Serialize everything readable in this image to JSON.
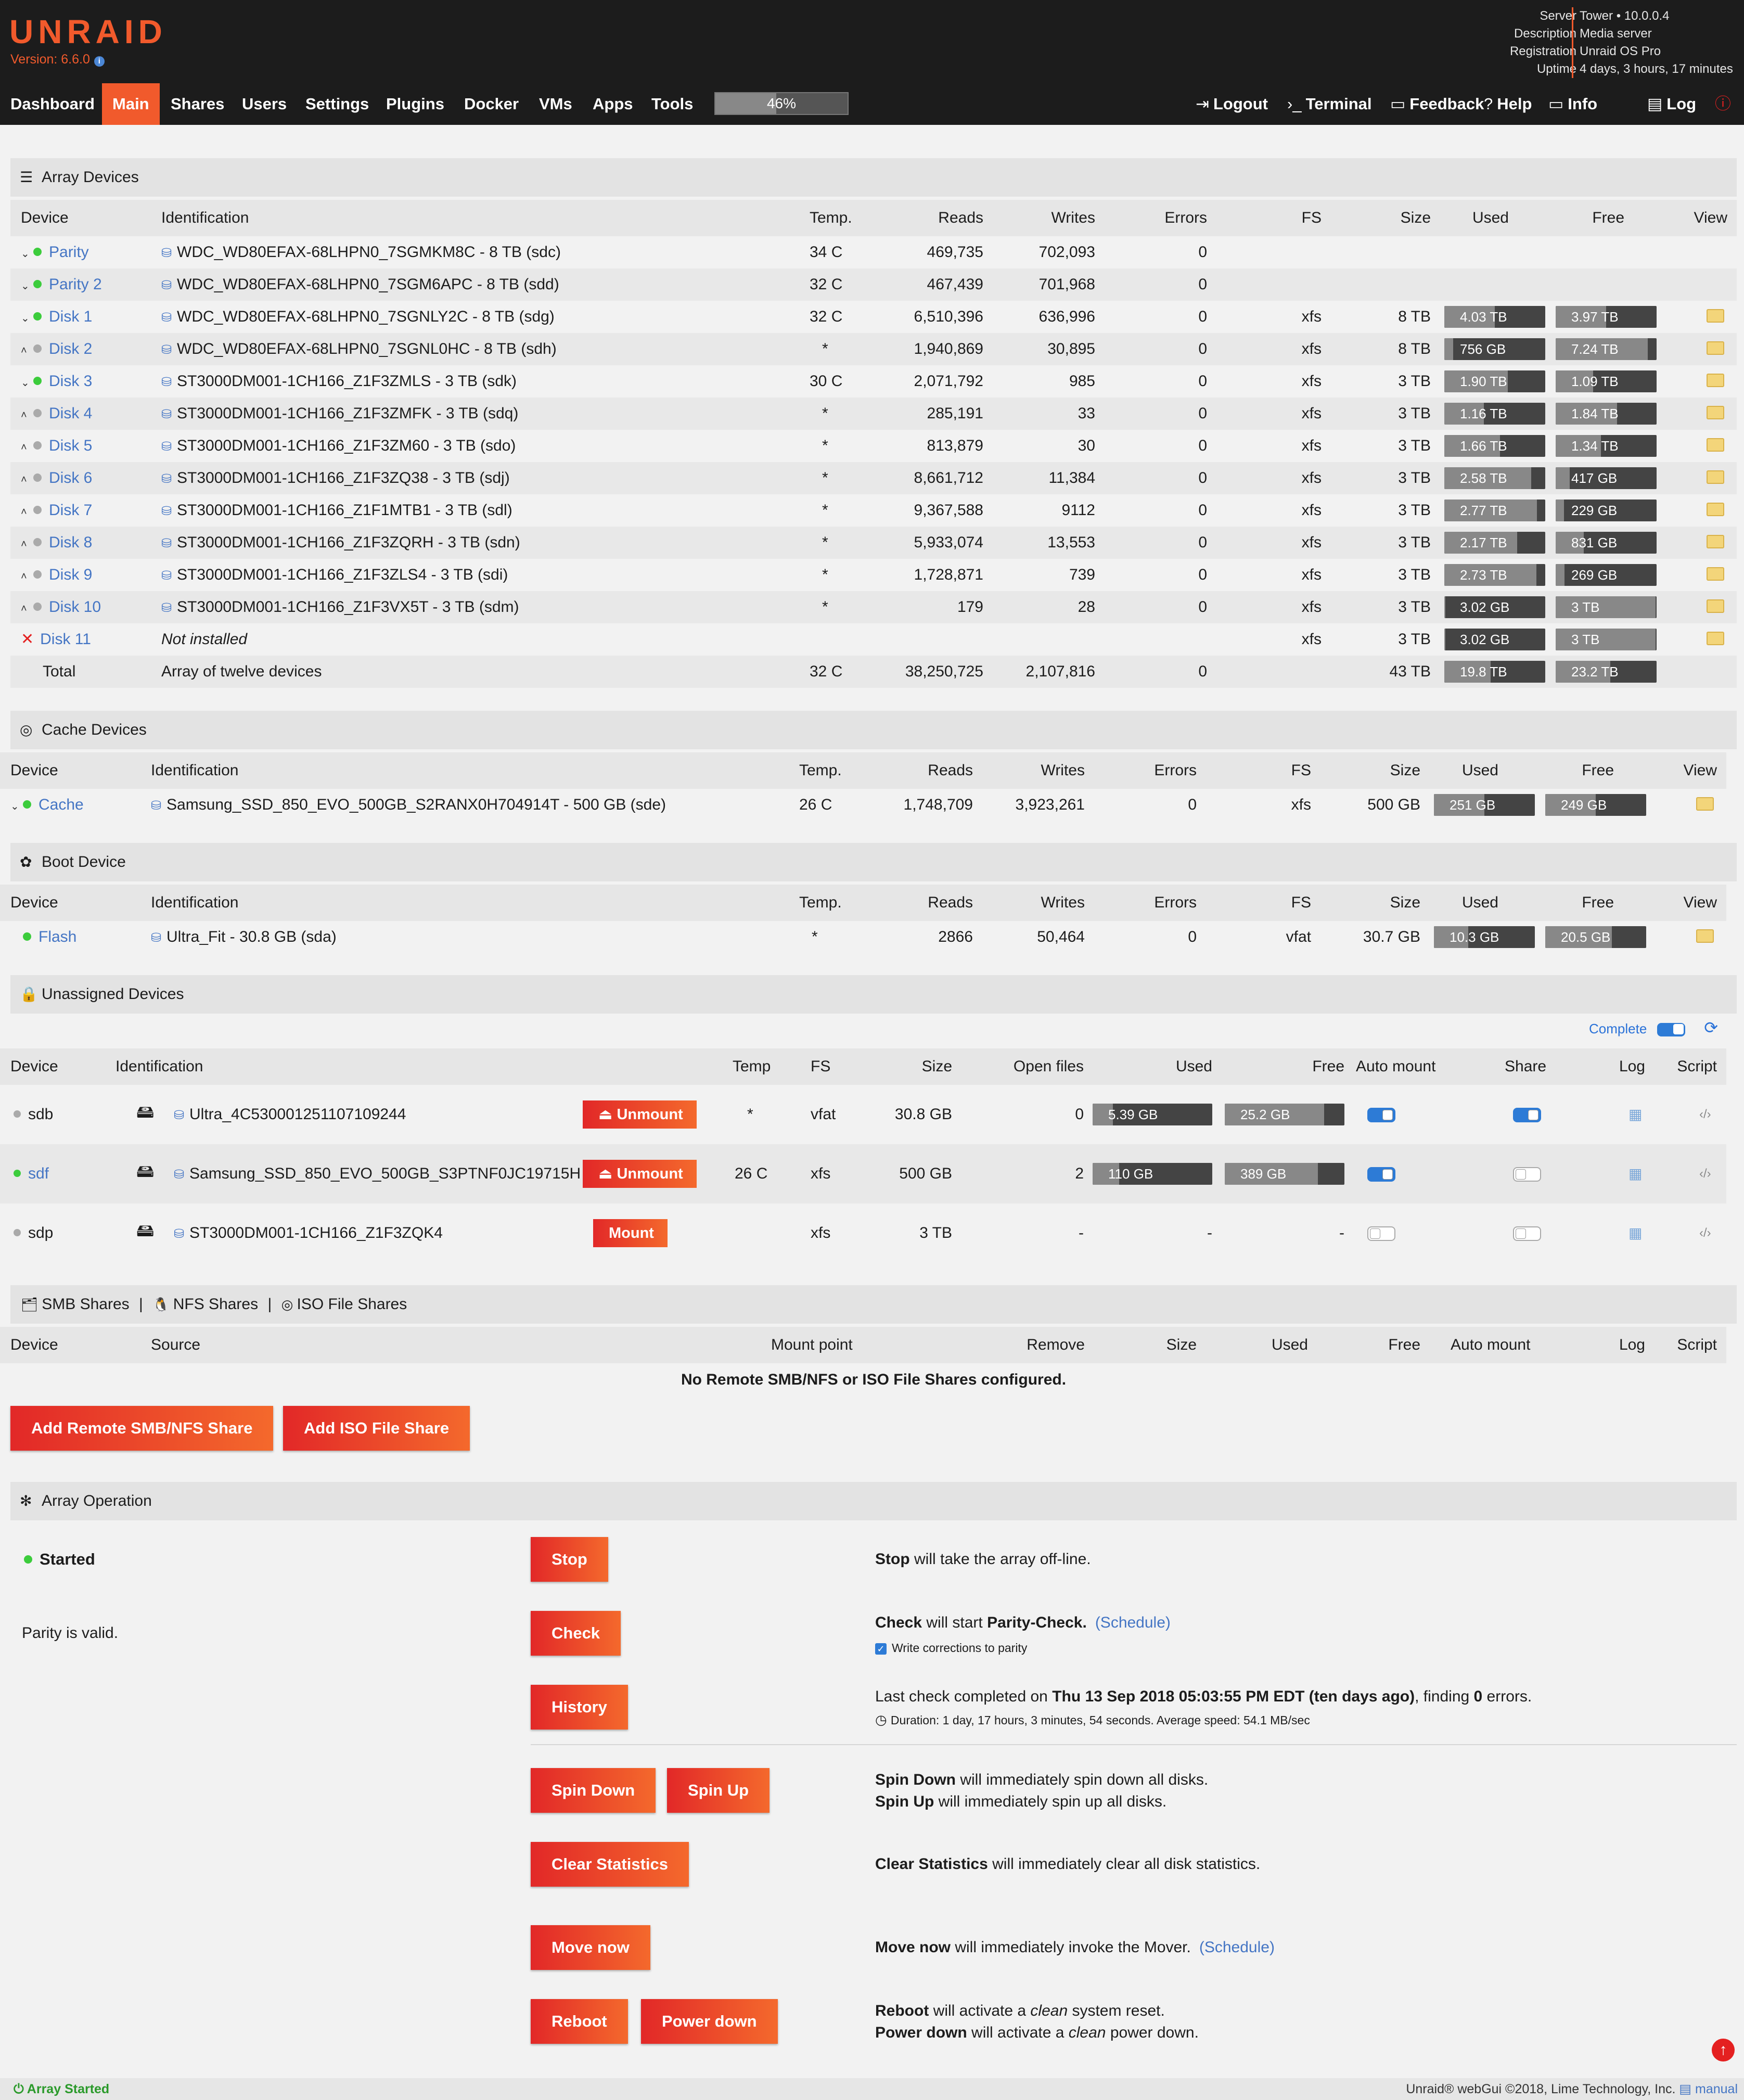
{
  "header": {
    "logo": "UNRAID",
    "version": "Version: 6.6.0",
    "server_labels": [
      "Server",
      "Description",
      "Registration",
      "Uptime"
    ],
    "server_values": [
      "Tower • 10.0.0.4",
      "Media server",
      "Unraid OS Pro",
      "4 days, 3 hours, 17 minutes"
    ]
  },
  "nav": {
    "tabs": [
      "Dashboard",
      "Main",
      "Shares",
      "Users",
      "Settings",
      "Plugins",
      "Docker",
      "VMs",
      "Apps",
      "Tools"
    ],
    "active": "Main",
    "cpu_percent": 46,
    "cpu_label": "46%",
    "right": [
      "Logout",
      "Terminal",
      "Feedback",
      "Help",
      "Info",
      "Log"
    ]
  },
  "array": {
    "title": "Array Devices",
    "headers": [
      "Device",
      "Identification",
      "Temp.",
      "Reads",
      "Writes",
      "Errors",
      "FS",
      "Size",
      "Used",
      "Free",
      "View"
    ],
    "rows": [
      {
        "dev": "Parity",
        "id": "WDC_WD80EFAX-68LHPN0_7SGMKM8C - 8 TB (sdc)",
        "temp": "34 C",
        "reads": "469,735",
        "writes": "702,093",
        "errors": "0",
        "fs": "",
        "size": "",
        "used": "",
        "free": "",
        "uf": 0,
        "ff": 0,
        "status": "green",
        "arrow": "down"
      },
      {
        "dev": "Parity 2",
        "id": "WDC_WD80EFAX-68LHPN0_7SGM6APC - 8 TB (sdd)",
        "temp": "32 C",
        "reads": "467,439",
        "writes": "701,968",
        "errors": "0",
        "fs": "",
        "size": "",
        "used": "",
        "free": "",
        "uf": 0,
        "ff": 0,
        "status": "green",
        "arrow": "down"
      },
      {
        "dev": "Disk 1",
        "id": "WDC_WD80EFAX-68LHPN0_7SGNLY2C - 8 TB (sdg)",
        "temp": "32 C",
        "reads": "6,510,396",
        "writes": "636,996",
        "errors": "0",
        "fs": "xfs",
        "size": "8 TB",
        "used": "4.03 TB",
        "free": "3.97 TB",
        "uf": 0.5,
        "ff": 0.5,
        "status": "green",
        "arrow": "down"
      },
      {
        "dev": "Disk 2",
        "id": "WDC_WD80EFAX-68LHPN0_7SGNL0HC - 8 TB (sdh)",
        "temp": "*",
        "reads": "1,940,869",
        "writes": "30,895",
        "errors": "0",
        "fs": "xfs",
        "size": "8 TB",
        "used": "756 GB",
        "free": "7.24 TB",
        "uf": 0.09,
        "ff": 0.91,
        "status": "gray",
        "arrow": "up"
      },
      {
        "dev": "Disk 3",
        "id": "ST3000DM001-1CH166_Z1F3ZMLS - 3 TB (sdk)",
        "temp": "30 C",
        "reads": "2,071,792",
        "writes": "985",
        "errors": "0",
        "fs": "xfs",
        "size": "3 TB",
        "used": "1.90 TB",
        "free": "1.09 TB",
        "uf": 0.63,
        "ff": 0.37,
        "status": "green",
        "arrow": "down"
      },
      {
        "dev": "Disk 4",
        "id": "ST3000DM001-1CH166_Z1F3ZMFK - 3 TB (sdq)",
        "temp": "*",
        "reads": "285,191",
        "writes": "33",
        "errors": "0",
        "fs": "xfs",
        "size": "3 TB",
        "used": "1.16 TB",
        "free": "1.84 TB",
        "uf": 0.39,
        "ff": 0.61,
        "status": "gray",
        "arrow": "up"
      },
      {
        "dev": "Disk 5",
        "id": "ST3000DM001-1CH166_Z1F3ZM60 - 3 TB (sdo)",
        "temp": "*",
        "reads": "813,879",
        "writes": "30",
        "errors": "0",
        "fs": "xfs",
        "size": "3 TB",
        "used": "1.66 TB",
        "free": "1.34 TB",
        "uf": 0.55,
        "ff": 0.45,
        "status": "gray",
        "arrow": "up"
      },
      {
        "dev": "Disk 6",
        "id": "ST3000DM001-1CH166_Z1F3ZQ38 - 3 TB (sdj)",
        "temp": "*",
        "reads": "8,661,712",
        "writes": "11,384",
        "errors": "0",
        "fs": "xfs",
        "size": "3 TB",
        "used": "2.58 TB",
        "free": "417 GB",
        "uf": 0.86,
        "ff": 0.14,
        "status": "gray",
        "arrow": "up"
      },
      {
        "dev": "Disk 7",
        "id": "ST3000DM001-1CH166_Z1F1MTB1 - 3 TB (sdl)",
        "temp": "*",
        "reads": "9,367,588",
        "writes": "9112",
        "errors": "0",
        "fs": "xfs",
        "size": "3 TB",
        "used": "2.77 TB",
        "free": "229 GB",
        "uf": 0.92,
        "ff": 0.08,
        "status": "gray",
        "arrow": "up"
      },
      {
        "dev": "Disk 8",
        "id": "ST3000DM001-1CH166_Z1F3ZQRH - 3 TB (sdn)",
        "temp": "*",
        "reads": "5,933,074",
        "writes": "13,553",
        "errors": "0",
        "fs": "xfs",
        "size": "3 TB",
        "used": "2.17 TB",
        "free": "831 GB",
        "uf": 0.72,
        "ff": 0.28,
        "status": "gray",
        "arrow": "up"
      },
      {
        "dev": "Disk 9",
        "id": "ST3000DM001-1CH166_Z1F3ZLS4 - 3 TB (sdi)",
        "temp": "*",
        "reads": "1,728,871",
        "writes": "739",
        "errors": "0",
        "fs": "xfs",
        "size": "3 TB",
        "used": "2.73 TB",
        "free": "269 GB",
        "uf": 0.91,
        "ff": 0.09,
        "status": "gray",
        "arrow": "up"
      },
      {
        "dev": "Disk 10",
        "id": "ST3000DM001-1CH166_Z1F3VX5T - 3 TB (sdm)",
        "temp": "*",
        "reads": "179",
        "writes": "28",
        "errors": "0",
        "fs": "xfs",
        "size": "3 TB",
        "used": "3.02 GB",
        "free": "3 TB",
        "uf": 0.01,
        "ff": 0.99,
        "status": "gray",
        "arrow": "up"
      },
      {
        "dev": "Disk 11",
        "id": "Not installed",
        "temp": "",
        "reads": "",
        "writes": "",
        "errors": "",
        "fs": "xfs",
        "size": "3 TB",
        "used": "3.02 GB",
        "free": "3 TB",
        "uf": 0.01,
        "ff": 0.99,
        "status": "missing",
        "arrow": ""
      },
      {
        "dev": "Total",
        "id": "Array of twelve devices",
        "temp": "32 C",
        "reads": "38,250,725",
        "writes": "2,107,816",
        "errors": "0",
        "fs": "",
        "size": "43 TB",
        "used": "19.8 TB",
        "free": "23.2 TB",
        "uf": 0.46,
        "ff": 0.54,
        "status": "total",
        "arrow": ""
      }
    ]
  },
  "cache": {
    "title": "Cache Devices",
    "headers": [
      "Device",
      "Identification",
      "Temp.",
      "Reads",
      "Writes",
      "Errors",
      "FS",
      "Size",
      "Used",
      "Free",
      "View"
    ],
    "rows": [
      {
        "dev": "Cache",
        "id": "Samsung_SSD_850_EVO_500GB_S2RANX0H704914T - 500 GB (sde)",
        "temp": "26 C",
        "reads": "1,748,709",
        "writes": "3,923,261",
        "errors": "0",
        "fs": "xfs",
        "size": "500 GB",
        "used": "251 GB",
        "free": "249 GB",
        "uf": 0.5,
        "ff": 0.5,
        "status": "green",
        "arrow": "down"
      }
    ]
  },
  "boot": {
    "title": "Boot Device",
    "headers": [
      "Device",
      "Identification",
      "Temp.",
      "Reads",
      "Writes",
      "Errors",
      "FS",
      "Size",
      "Used",
      "Free",
      "View"
    ],
    "rows": [
      {
        "dev": "Flash",
        "id": "Ultra_Fit - 30.8 GB (sda)",
        "temp": "*",
        "reads": "2866",
        "writes": "50,464",
        "errors": "0",
        "fs": "vfat",
        "size": "30.7 GB",
        "used": "10.3 GB",
        "free": "20.5 GB",
        "uf": 0.34,
        "ff": 0.66,
        "status": "green",
        "arrow": ""
      }
    ]
  },
  "unassigned": {
    "title": "Unassigned Devices",
    "complete": "Complete",
    "headers": [
      "Device",
      "Identification",
      "Temp",
      "FS",
      "Size",
      "Open files",
      "Used",
      "Free",
      "Auto mount",
      "Share",
      "Log",
      "Script"
    ],
    "rows": [
      {
        "dev": "sdb",
        "id": "Ultra_4C530001251107109244",
        "btn": "Unmount",
        "temp": "*",
        "fs": "vfat",
        "size": "30.8 GB",
        "open": "0",
        "used": "5.39 GB",
        "free": "25.2 GB",
        "uf": 0.17,
        "ff": 0.83,
        "auto": true,
        "share": true,
        "status": "gray"
      },
      {
        "dev": "sdf",
        "id": "Samsung_SSD_850_EVO_500GB_S3PTNF0JC19715H",
        "btn": "Unmount",
        "temp": "26 C",
        "fs": "xfs",
        "size": "500 GB",
        "open": "2",
        "used": "110 GB",
        "free": "389 GB",
        "uf": 0.22,
        "ff": 0.78,
        "auto": true,
        "share": false,
        "status": "green"
      },
      {
        "dev": "sdp",
        "id": "ST3000DM001-1CH166_Z1F3ZQK4",
        "btn": "Mount",
        "temp": "",
        "fs": "xfs",
        "size": "3 TB",
        "open": "-",
        "used": "-",
        "free": "-",
        "uf": 0,
        "ff": 0,
        "auto": false,
        "share": false,
        "status": "gray"
      }
    ]
  },
  "shares": {
    "tabs": [
      "SMB Shares",
      "NFS Shares",
      "ISO File Shares"
    ],
    "headers": [
      "Device",
      "Source",
      "Mount point",
      "Remove",
      "Size",
      "Used",
      "Free",
      "Auto mount",
      "Log",
      "Script"
    ],
    "empty": "No Remote SMB/NFS or ISO File Shares configured.",
    "add_smb": "Add Remote SMB/NFS Share",
    "add_iso": "Add ISO File Share"
  },
  "operation": {
    "title": "Array Operation",
    "state": "Started",
    "parity_status": "Parity is valid.",
    "stop": "Stop",
    "stop_desc_b": "Stop",
    "stop_desc": " will take the array off-line.",
    "check": "Check",
    "check_desc_b": "Check",
    "check_desc_1": " will start ",
    "check_desc_b2": "Parity-Check.",
    "schedule": "(Schedule)",
    "write_corr": "Write corrections to parity",
    "history": "History",
    "hist_desc_1": "Last check completed on ",
    "hist_desc_b": "Thu 13 Sep 2018 05:03:55 PM EDT (ten days ago)",
    "hist_desc_2": ", finding ",
    "hist_desc_b2": "0",
    "hist_desc_3": " errors.",
    "duration": "Duration: 1 day, 17 hours, 3 minutes, 54 seconds. Average speed: 54.1 MB/sec",
    "spindown": "Spin Down",
    "spinup": "Spin Up",
    "sd_desc_b": "Spin Down",
    "sd_desc": " will immediately spin down all disks.",
    "su_desc_b": "Spin Up",
    "su_desc": " will immediately spin up all disks.",
    "clear": "Clear Statistics",
    "clear_desc_b": "Clear Statistics",
    "clear_desc": " will immediately clear all disk statistics.",
    "move": "Move now",
    "move_desc_b": "Move now",
    "move_desc": " will immediately invoke the Mover.",
    "reboot": "Reboot",
    "powerdown": "Power down",
    "rb_desc_b": "Reboot",
    "rb_desc_1": " will activate a ",
    "rb_desc_i": "clean",
    "rb_desc_2": " system reset.",
    "pd_desc_b": "Power down",
    "pd_desc_1": " will activate a ",
    "pd_desc_i": "clean",
    "pd_desc_2": " power down."
  },
  "footer": {
    "status": "Array Started",
    "copyright": "Unraid® webGui ©2018, Lime Technology, Inc.",
    "manual": "manual"
  }
}
